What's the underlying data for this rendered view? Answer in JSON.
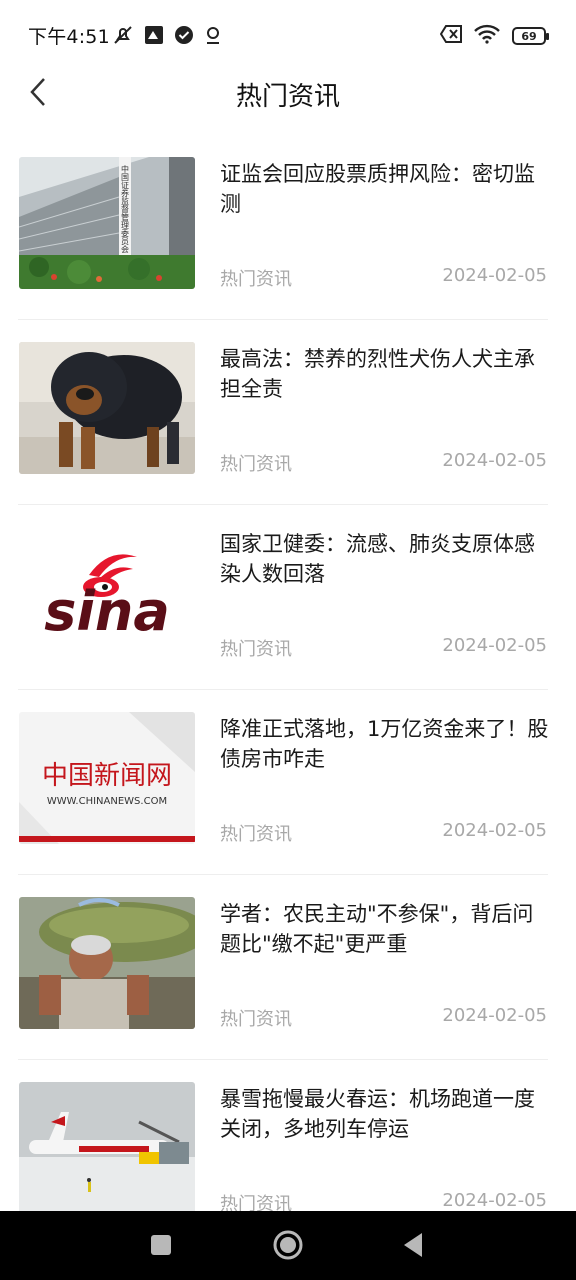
{
  "status_bar": {
    "time": "下午4:51",
    "battery": "69"
  },
  "header": {
    "title": "热门资讯"
  },
  "news": [
    {
      "title": "证监会回应股票质押风险：密切监测",
      "source": "热门资讯",
      "date": "2024-02-05",
      "image": "building-photo"
    },
    {
      "title": "最高法：禁养的烈性犬伤人犬主承担全责",
      "source": "热门资讯",
      "date": "2024-02-05",
      "image": "mastiff-photo"
    },
    {
      "title": "国家卫健委：流感、肺炎支原体感染人数回落",
      "source": "热门资讯",
      "date": "2024-02-05",
      "image": "sina-logo"
    },
    {
      "title": "降准正式落地，1万亿资金来了！股债房市咋走",
      "source": "热门资讯",
      "date": "2024-02-05",
      "image": "chinanews-logo"
    },
    {
      "title": "学者：农民主动\"不参保\"，背后问题比\"缴不起\"更严重",
      "source": "热门资讯",
      "date": "2024-02-05",
      "image": "farmer-photo"
    },
    {
      "title": "暴雪拖慢最火春运：机场跑道一度关闭，多地列车停运",
      "source": "热门资讯",
      "date": "2024-02-05",
      "image": "airport-snow-photo"
    }
  ],
  "logos": {
    "sina": "sina",
    "chinanews_cn": "中国新闻网",
    "chinanews_url": "WWW.CHINANEWS.COM",
    "building_sign": "中国证券监督管理委员会"
  }
}
